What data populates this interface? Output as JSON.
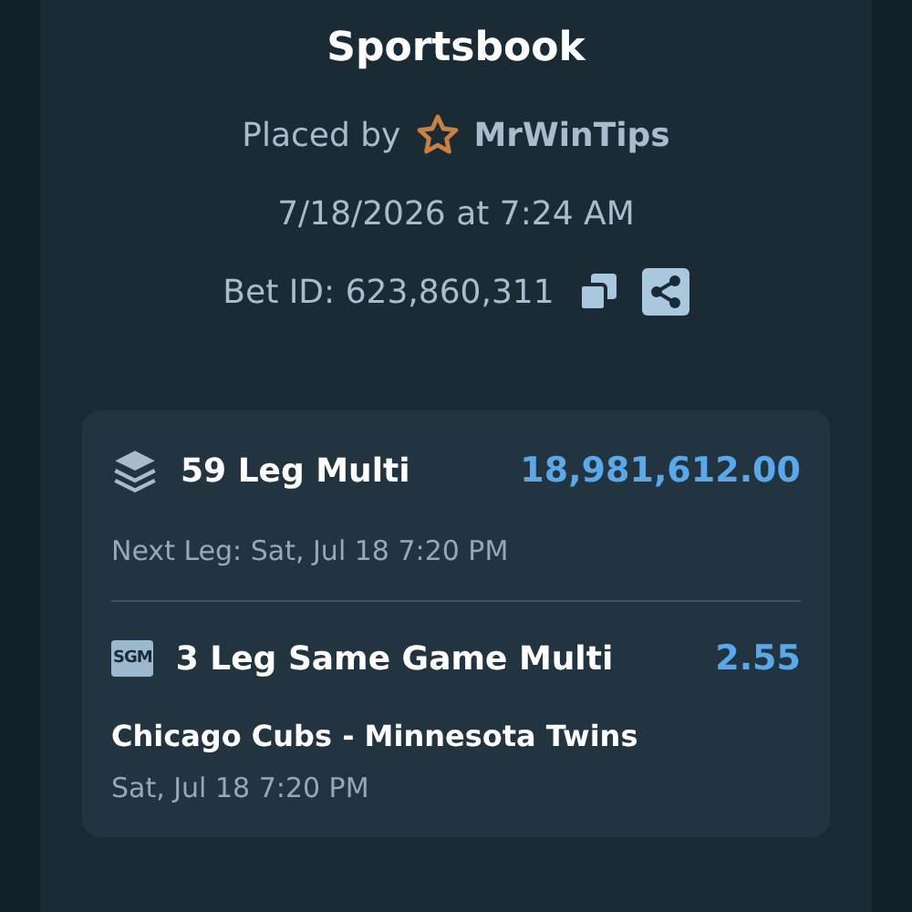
{
  "header": {
    "title": "Sportsbook",
    "placed_by_label": "Placed by",
    "user": "MrWinTips",
    "timestamp": "7/18/2026 at 7:24 AM",
    "bet_id": "Bet ID: 623,860,311"
  },
  "bets": [
    {
      "kind": "multi",
      "title": "59 Leg Multi",
      "odds": "18,981,612.00",
      "detail": "Next Leg: Sat, Jul 18 7:20 PM"
    },
    {
      "kind": "sgm",
      "badge": "SGM",
      "title": "3 Leg Same Game Multi",
      "odds": "2.55",
      "match": "Chicago Cubs - Minnesota Twins",
      "detail": "Sat, Jul 18 7:20 PM"
    }
  ]
}
